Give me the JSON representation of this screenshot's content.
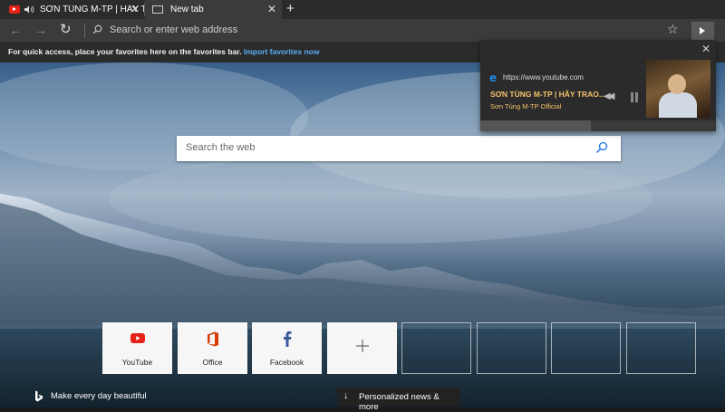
{
  "tabs": [
    {
      "label": "SƠN TÙNG M-TP | HÃY TRA",
      "favicon": "youtube-icon",
      "audio": "speaker-icon"
    },
    {
      "label": "New tab",
      "favicon": "newtab-icon"
    }
  ],
  "nav": {
    "address_placeholder": "Search or enter web address"
  },
  "favorites_bar": {
    "message": "For quick access, place your favorites here on the favorites bar.",
    "link": "Import favorites now"
  },
  "search": {
    "placeholder": "Search the web"
  },
  "tiles": [
    {
      "label": "YouTube",
      "icon": "youtube-icon"
    },
    {
      "label": "Office",
      "icon": "office-icon"
    },
    {
      "label": "Facebook",
      "icon": "facebook-icon"
    },
    {
      "label": "",
      "icon": "plus-icon"
    }
  ],
  "footer": {
    "bing_tagline": "Make every day beautiful",
    "news_button": "Personalized news & more"
  },
  "media_popup": {
    "url": "https://www.youtube.com",
    "title": "SƠN TÙNG M-TP | HÃY TRAO...",
    "artist": "Sơn Tùng M-TP Official",
    "progress": 0.47
  },
  "colors": {
    "accent_link": "#5aaef5",
    "media_text": "#f5c26b",
    "youtube_red": "#e62117",
    "office_red": "#d83b01",
    "facebook_blue": "#3b5998"
  }
}
